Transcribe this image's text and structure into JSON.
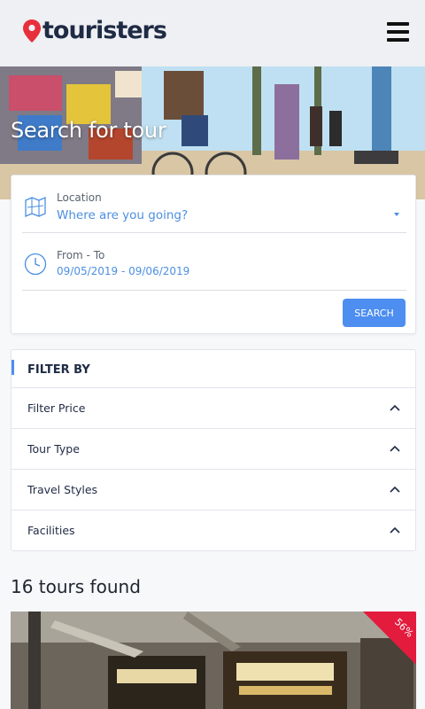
{
  "header": {
    "logo_text": "touristers"
  },
  "hero": {
    "title": "Search for tour"
  },
  "search": {
    "location_label": "Location",
    "location_placeholder": "Where are you going?",
    "date_label": "From - To",
    "date_value": "09/05/2019 - 09/06/2019",
    "button_label": "SEARCH"
  },
  "filter": {
    "title": "FILTER BY",
    "items": [
      {
        "label": "Filter Price"
      },
      {
        "label": "Tour Type"
      },
      {
        "label": "Travel Styles"
      },
      {
        "label": "Facilities"
      }
    ]
  },
  "results": {
    "count_text": "16 tours found",
    "first_tour": {
      "discount": "56%"
    }
  },
  "colors": {
    "accent": "#4d8ef0",
    "link": "#4b8fe0",
    "logo_pin": "#e8303c",
    "badge": "#e31b3d"
  }
}
